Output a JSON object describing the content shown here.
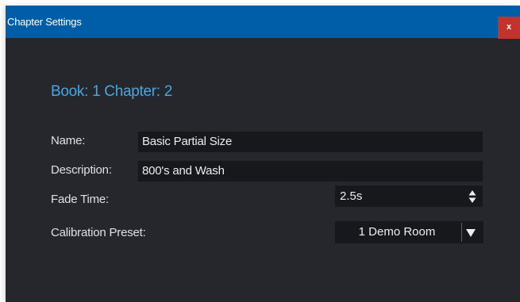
{
  "window": {
    "title": "Chapter Settings",
    "close_label": "x"
  },
  "heading": "Book: 1 Chapter: 2",
  "form": {
    "name_label": "Name:",
    "name_value": "Basic Partial Size",
    "description_label": "Description:",
    "description_value": "800's and Wash",
    "fade_time_label": "Fade Time:",
    "fade_time_value": "2.5s",
    "calibration_label": "Calibration Preset:",
    "calibration_value": "1 Demo Room"
  },
  "colors": {
    "titlebar": "#005ea8",
    "close": "#c1332c",
    "background": "#25272c",
    "field": "#16181c",
    "heading": "#4aa6e0"
  },
  "icons": {
    "stepper": "up-down-arrows-icon",
    "dropdown": "triangle-down-icon"
  }
}
